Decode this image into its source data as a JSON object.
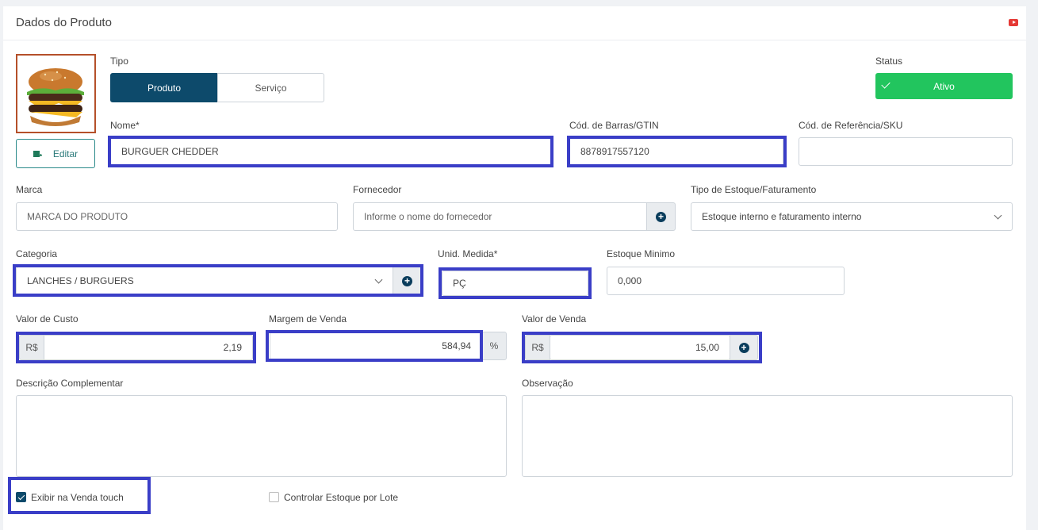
{
  "header": {
    "title": "Dados do Produto",
    "help_icon": "youtube-icon"
  },
  "image": {
    "edit_label": "Editar",
    "edit_icon": "image-edit-icon"
  },
  "tipo": {
    "label": "Tipo",
    "options": [
      "Produto",
      "Serviço"
    ],
    "selected": "Produto"
  },
  "status": {
    "label": "Status",
    "value": "Ativo",
    "icon": "check-icon"
  },
  "fields": {
    "nome": {
      "label": "Nome*",
      "value": "BURGUER CHEDDER"
    },
    "barras": {
      "label": "Cód. de Barras/GTIN",
      "value": "8878917557120"
    },
    "sku": {
      "label": "Cód. de Referência/SKU",
      "value": ""
    },
    "marca": {
      "label": "Marca",
      "placeholder": "MARCA DO PRODUTO"
    },
    "fornecedor": {
      "label": "Fornecedor",
      "placeholder": "Informe o nome do fornecedor"
    },
    "tipo_estoque": {
      "label": "Tipo de Estoque/Faturamento",
      "value": "Estoque interno e faturamento interno"
    },
    "categoria": {
      "label": "Categoria",
      "value": "LANCHES / BURGUERS"
    },
    "unid": {
      "label": "Unid. Medida*",
      "value": "PÇ"
    },
    "estoque_min": {
      "label": "Estoque Minimo",
      "value": "0,000"
    },
    "custo": {
      "label": "Valor de Custo",
      "prefix": "R$",
      "value": "2,19"
    },
    "margem": {
      "label": "Margem de Venda",
      "value": "584,94",
      "suffix": "%"
    },
    "venda": {
      "label": "Valor de Venda",
      "prefix": "R$",
      "value": "15,00"
    },
    "descricao": {
      "label": "Descrição Complementar",
      "value": ""
    },
    "observacao": {
      "label": "Observação",
      "value": ""
    }
  },
  "checks": {
    "venda_touch": {
      "label": "Exibir na Venda touch",
      "checked": true
    },
    "estoque_lote": {
      "label": "Controlar Estoque por Lote",
      "checked": false
    }
  },
  "colors": {
    "primary": "#0d4a6b",
    "success": "#22c55e",
    "highlight": "#3a3ec7",
    "image_border": "#b5502a"
  }
}
